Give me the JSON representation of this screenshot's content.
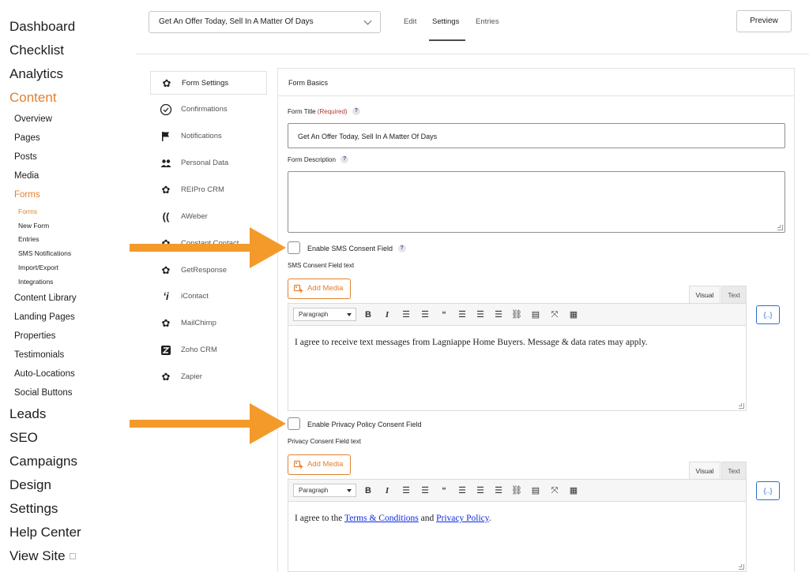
{
  "nav": {
    "dashboard": "Dashboard",
    "checklist": "Checklist",
    "analytics": "Analytics",
    "content": "Content",
    "content_items": [
      "Overview",
      "Pages",
      "Posts",
      "Media",
      "Forms"
    ],
    "forms_items": [
      "Forms",
      "New Form",
      "Entries",
      "SMS Notifications",
      "Import/Export",
      "Integrations"
    ],
    "content_items_2": [
      "Content Library",
      "Landing Pages",
      "Properties",
      "Testimonials",
      "Auto-Locations",
      "Social Buttons"
    ],
    "bottom_items": [
      "Leads",
      "SEO",
      "Campaigns",
      "Design",
      "Settings",
      "Help Center",
      "View Site"
    ]
  },
  "header": {
    "form_select_value": "Get An Offer Today, Sell In A Matter Of Days",
    "tabs": [
      "Edit",
      "Settings",
      "Entries"
    ],
    "active_tab": "Settings",
    "preview_label": "Preview"
  },
  "settings_menu": [
    {
      "label": "Form Settings",
      "icon": "gear-icon",
      "active": true
    },
    {
      "label": "Confirmations",
      "icon": "check-circle-icon"
    },
    {
      "label": "Notifications",
      "icon": "flag-icon"
    },
    {
      "label": "Personal Data",
      "icon": "users-icon"
    },
    {
      "label": "REIPro CRM",
      "icon": "gear-icon"
    },
    {
      "label": "AWeber",
      "icon": "aweber-icon"
    },
    {
      "label": "Constant Contact",
      "icon": "gear-icon"
    },
    {
      "label": "GetResponse",
      "icon": "gear-icon"
    },
    {
      "label": "iContact",
      "icon": "icontact-icon"
    },
    {
      "label": "MailChimp",
      "icon": "gear-icon"
    },
    {
      "label": "Zoho CRM",
      "icon": "zoho-icon"
    },
    {
      "label": "Zapier",
      "icon": "gear-icon"
    }
  ],
  "panel": {
    "title": "Form Basics",
    "form_title_label": "Form Title",
    "required_text": "(Required)",
    "form_title_value": "Get An Offer Today, Sell In A Matter Of Days",
    "form_description_label": "Form Description",
    "help_glyph": "?",
    "sms": {
      "checkbox_label": "Enable SMS Consent Field",
      "field_text_label": "SMS Consent Field text",
      "content": "I agree to receive text messages from Lagniappe Home Buyers. Message & data rates may apply."
    },
    "privacy": {
      "checkbox_label": "Enable Privacy Policy Consent Field",
      "field_text_label": "Privacy Consent Field text",
      "content_prefix": "I agree to the ",
      "terms_link": "Terms & Conditions",
      "content_and": " and ",
      "privacy_link": "Privacy Policy",
      "content_suffix": "."
    },
    "editor": {
      "add_media_label": "Add Media",
      "tab_visual": "Visual",
      "tab_text": "Text",
      "format_value": "Paragraph",
      "merge_tag_label": "{..}",
      "toolbar_icons": [
        "bold-icon",
        "italic-icon",
        "bullet-list-icon",
        "numbered-list-icon",
        "blockquote-icon",
        "align-left-icon",
        "align-center-icon",
        "align-right-icon",
        "link-icon",
        "read-more-icon",
        "fullscreen-icon",
        "toolbar-toggle-icon"
      ]
    }
  },
  "colors": {
    "accent": "#e2812e",
    "arrow": "#f39a2b",
    "link": "#0f2ae0",
    "merge_tag": "#2f6bd3"
  }
}
